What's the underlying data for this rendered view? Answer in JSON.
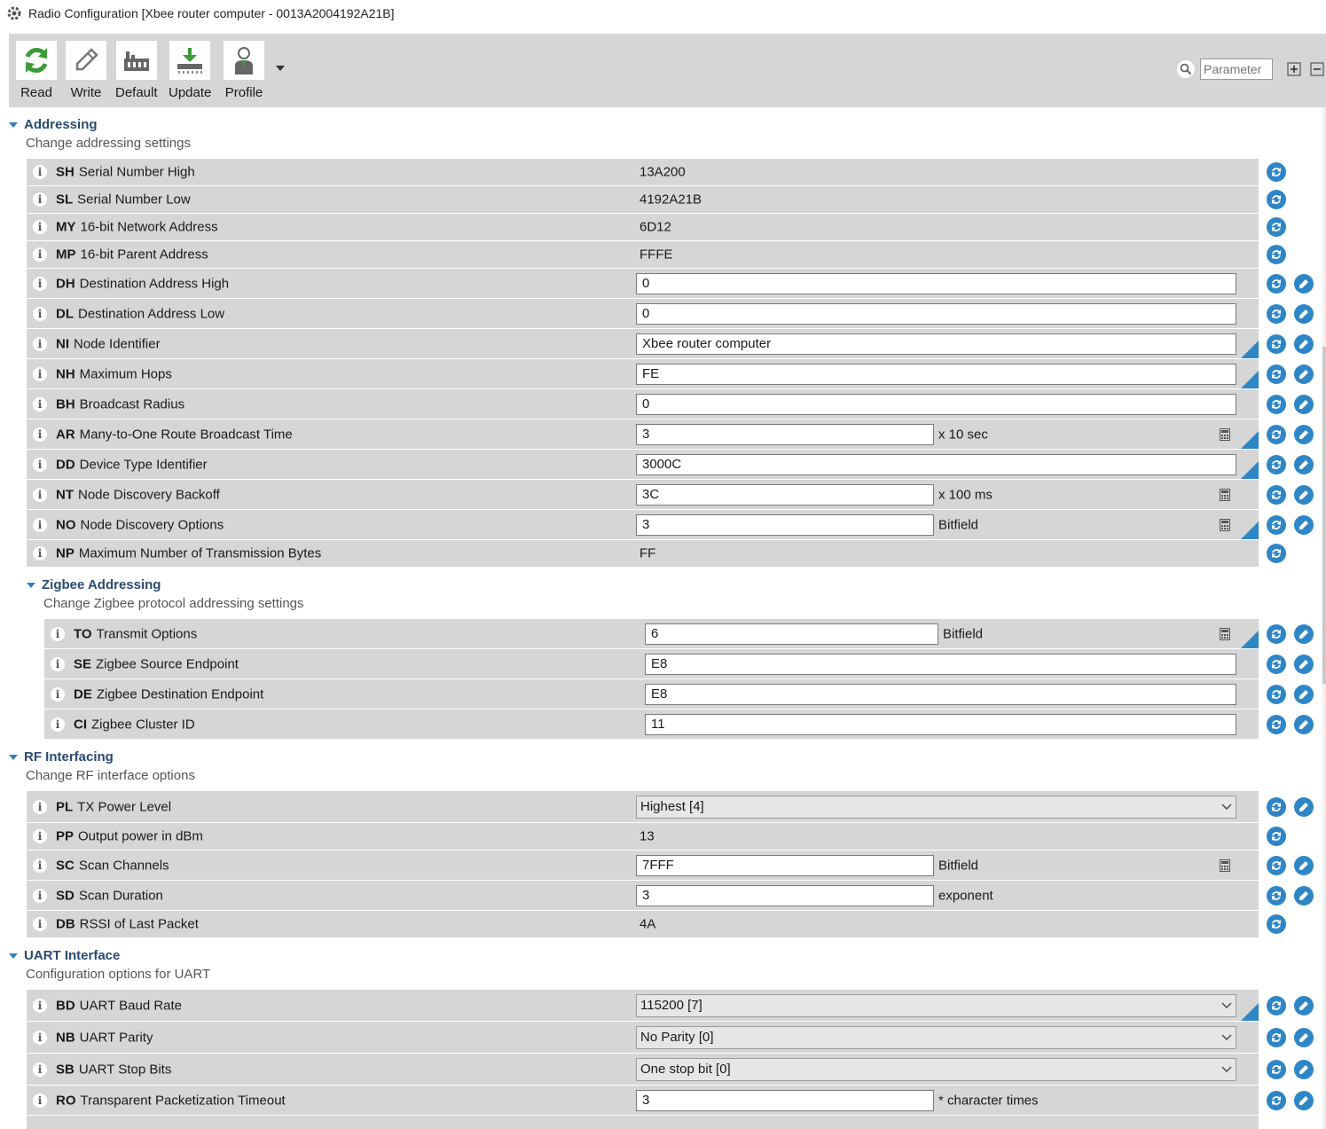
{
  "window": {
    "title": "Radio Configuration [Xbee router computer - 0013A2004192A21B]"
  },
  "toolbar": {
    "buttons": [
      {
        "label": "Read",
        "icon": "read-icon"
      },
      {
        "label": "Write",
        "icon": "pencil-icon"
      },
      {
        "label": "Default",
        "icon": "factory-icon"
      },
      {
        "label": "Update",
        "icon": "download-icon"
      },
      {
        "label": "Profile",
        "icon": "person-icon"
      }
    ],
    "search_placeholder": "Parameter"
  },
  "colors": {
    "accent": "#2f86c6",
    "row_bg": "#d6d6d6",
    "toolbar_bg": "#d6d6d6"
  },
  "sections": {
    "addressing": {
      "title": "Addressing",
      "desc": "Change addressing settings",
      "rows": [
        {
          "code": "SH",
          "name": "Serial Number High",
          "value": "13A200"
        },
        {
          "code": "SL",
          "name": "Serial Number Low",
          "value": "4192A21B"
        },
        {
          "code": "MY",
          "name": "16-bit Network Address",
          "value": "6D12"
        },
        {
          "code": "MP",
          "name": "16-bit Parent Address",
          "value": "FFFE"
        },
        {
          "code": "DH",
          "name": "Destination Address High",
          "value": "0"
        },
        {
          "code": "DL",
          "name": "Destination Address Low",
          "value": "0"
        },
        {
          "code": "NI",
          "name": "Node Identifier",
          "value": "Xbee router computer"
        },
        {
          "code": "NH",
          "name": "Maximum Hops",
          "value": "FE"
        },
        {
          "code": "BH",
          "name": "Broadcast Radius",
          "value": "0"
        },
        {
          "code": "AR",
          "name": "Many-to-One Route Broadcast Time",
          "value": "3",
          "unit": "x 10 sec"
        },
        {
          "code": "DD",
          "name": "Device Type Identifier",
          "value": "3000C"
        },
        {
          "code": "NT",
          "name": "Node Discovery Backoff",
          "value": "3C",
          "unit": "x 100 ms"
        },
        {
          "code": "NO",
          "name": "Node Discovery Options",
          "value": "3",
          "unit": "Bitfield"
        },
        {
          "code": "NP",
          "name": "Maximum Number of Transmission Bytes",
          "value": "FF"
        }
      ]
    },
    "zigbee": {
      "title": "Zigbee Addressing",
      "desc": "Change Zigbee protocol addressing settings",
      "rows": [
        {
          "code": "TO",
          "name": "Transmit Options",
          "value": "6",
          "unit": "Bitfield"
        },
        {
          "code": "SE",
          "name": "Zigbee Source Endpoint",
          "value": "E8"
        },
        {
          "code": "DE",
          "name": "Zigbee Destination Endpoint",
          "value": "E8"
        },
        {
          "code": "CI",
          "name": "Zigbee Cluster ID",
          "value": "11"
        }
      ]
    },
    "rf": {
      "title": "RF Interfacing",
      "desc": "Change RF interface options",
      "rows": [
        {
          "code": "PL",
          "name": "TX Power Level",
          "value": "Highest [4]"
        },
        {
          "code": "PP",
          "name": "Output power in dBm",
          "value": "13"
        },
        {
          "code": "SC",
          "name": "Scan Channels",
          "value": "7FFF",
          "unit": "Bitfield"
        },
        {
          "code": "SD",
          "name": "Scan Duration",
          "value": "3",
          "unit": "exponent"
        },
        {
          "code": "DB",
          "name": "RSSI of Last Packet",
          "value": "4A"
        }
      ]
    },
    "uart": {
      "title": "UART Interface",
      "desc": "Configuration options for UART",
      "rows": [
        {
          "code": "BD",
          "name": "UART Baud Rate",
          "value": "115200 [7]"
        },
        {
          "code": "NB",
          "name": "UART Parity",
          "value": "No Parity [0]"
        },
        {
          "code": "SB",
          "name": "UART Stop Bits",
          "value": "One stop bit [0]"
        },
        {
          "code": "RO",
          "name": "Transparent Packetization Timeout",
          "value": "3",
          "unit": "* character times"
        }
      ]
    }
  }
}
